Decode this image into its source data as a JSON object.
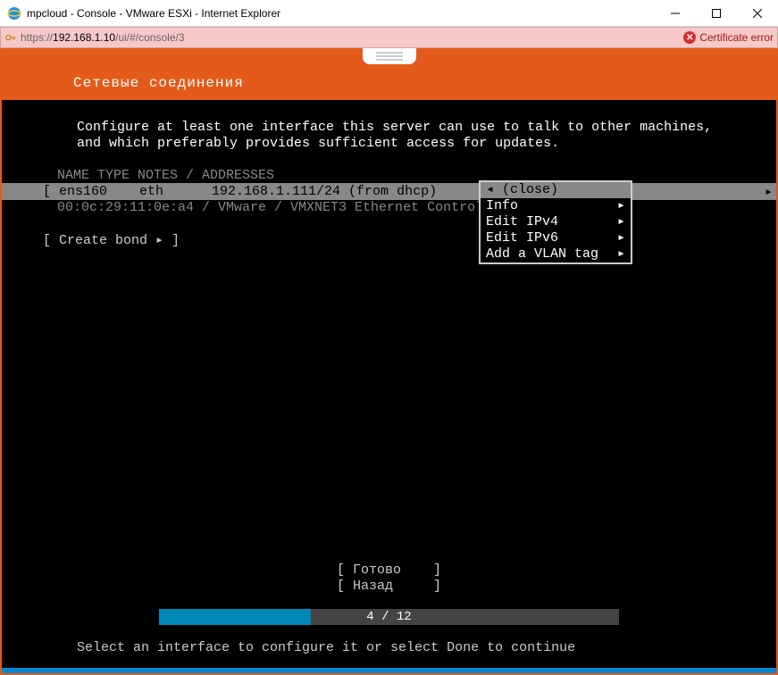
{
  "window": {
    "title": "mpcloud - Console - VMware ESXi - Internet Explorer"
  },
  "address": {
    "scheme": "https://",
    "host": "192.168.1.10",
    "path": "/ui/#/console/3",
    "cert_error": "Certificate error"
  },
  "header": {
    "title": "Сетевые соединения"
  },
  "instructions": {
    "line1": "Configure at least one interface this server can use to talk to other machines,",
    "line2": "and which preferably provides sufficient access for updates."
  },
  "columns": "NAME      TYPE     NOTES / ADDRESSES",
  "iface": {
    "row": "[ ens160    eth      192.168.1.111/24 (from dhcp)",
    "detail": "00:0c:29:11:0e:a4 / VMware / VMXNET3 Ethernet Controll"
  },
  "create_bond": "[ Create bond ▸ ]",
  "popup": {
    "close": "◂ (close)",
    "info": "Info",
    "ipv4": "Edit IPv4",
    "ipv6": "Edit IPv6",
    "vlan": "Add a VLAN tag",
    "arrow": "▸"
  },
  "buttons": {
    "done": "[ Готово    ]",
    "back": "[ Назад     ]"
  },
  "progress": {
    "label": "4 / 12",
    "percent": 33
  },
  "hint": "Select an interface to configure it or select Done to continue"
}
